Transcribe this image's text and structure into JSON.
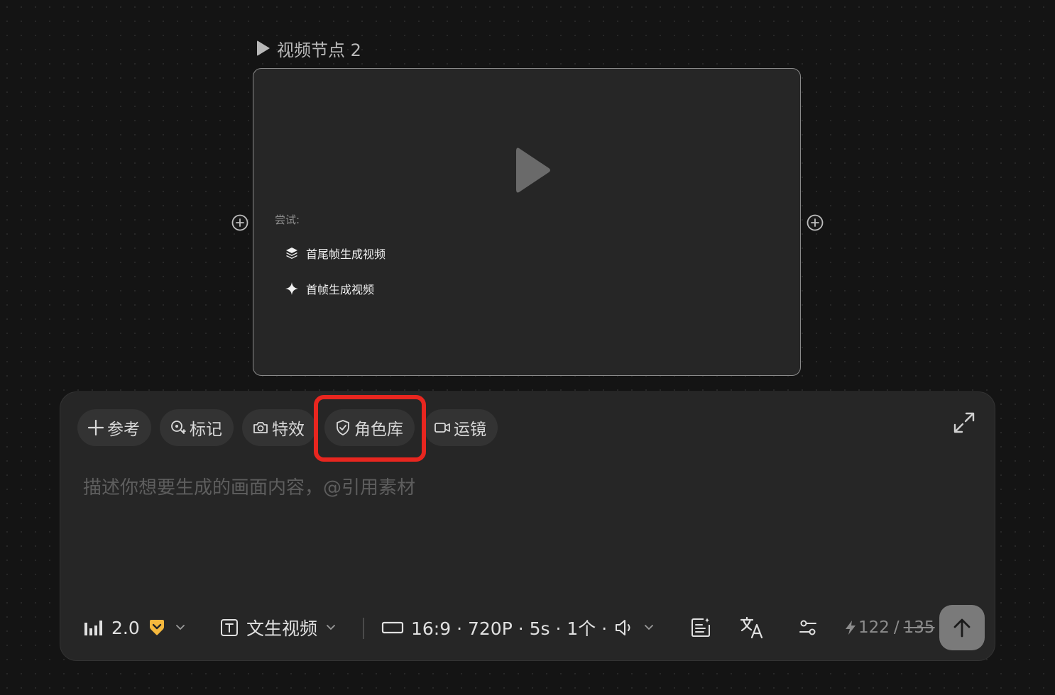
{
  "node": {
    "title": "视频节点 2",
    "try_label": "尝试:",
    "suggestions": [
      {
        "label": "首尾帧生成视频",
        "icon": "layers-icon"
      },
      {
        "label": "首帧生成视频",
        "icon": "sparkle-icon"
      }
    ]
  },
  "toolbar": {
    "chips": [
      {
        "label": "参考",
        "icon": "plus-icon"
      },
      {
        "label": "标记",
        "icon": "pin-search-icon"
      },
      {
        "label": "特效",
        "icon": "camera-icon"
      },
      {
        "label": "角色库",
        "icon": "shield-check-icon",
        "highlighted": true
      },
      {
        "label": "运镜",
        "icon": "video-camera-icon"
      }
    ]
  },
  "prompt": {
    "placeholder": "描述你想要生成的画面内容，@引用素材"
  },
  "bottom": {
    "model_version": "2.0",
    "mode": "文生视频",
    "settings": "16:9 · 720P · 5s · 1个 ·",
    "credits_current": "122",
    "credits_separator": "/",
    "credits_original": "135"
  },
  "colors": {
    "highlight": "#e8261f",
    "badge": "#f5b83d",
    "background": "#141414"
  }
}
